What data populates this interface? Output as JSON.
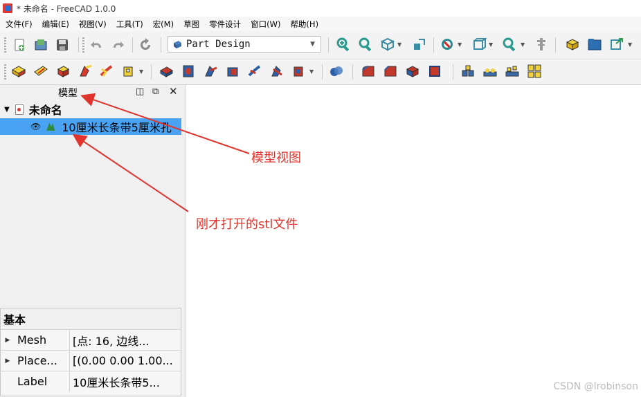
{
  "window": {
    "title": "* 未命名 - FreeCAD 1.0.0"
  },
  "menu": [
    "文件(F)",
    "编辑(E)",
    "视图(V)",
    "工具(T)",
    "宏(M)",
    "草图",
    "零件设计",
    "窗口(W)",
    "帮助(H)"
  ],
  "workbench": {
    "selected": "Part Design"
  },
  "panel": {
    "title": "模型"
  },
  "tree": {
    "root_label": "未命名",
    "item_label": "10厘米长条带5厘米孔"
  },
  "properties": {
    "group": "基本",
    "rows": [
      {
        "key": "Mesh",
        "value": "[点:  16,  边线..."
      },
      {
        "key": "Place...",
        "value": "[(0.00 0.00 1.00..."
      },
      {
        "key": "Label",
        "value": "10厘米长条带5..."
      }
    ]
  },
  "annotations": {
    "model_view": "模型视图",
    "stl_file": "刚才打开的stl文件"
  },
  "watermark": "CSDN @lrobinson",
  "colors": {
    "selection": "#4aa3f2",
    "annotation": "#e0342d"
  }
}
